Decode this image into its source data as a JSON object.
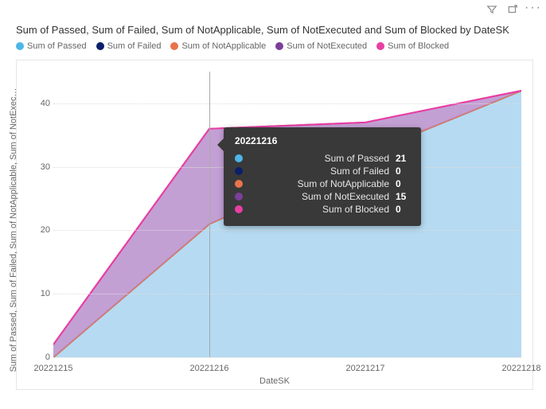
{
  "title": "Sum of Passed, Sum of Failed, Sum of NotApplicable, Sum of NotExecuted and Sum of Blocked by DateSK",
  "xlabel": "DateSK",
  "ylabel": "Sum of Passed, Sum of Failed, Sum of NotApplicable, Sum of NotExec…",
  "legend": {
    "passed": "Sum of Passed",
    "failed": "Sum of Failed",
    "na": "Sum of NotApplicable",
    "ne": "Sum of NotExecuted",
    "blocked": "Sum of Blocked"
  },
  "colors": {
    "passed": "#4db6e8",
    "failed": "#0b1f6b",
    "na": "#e8744c",
    "ne": "#7b3f9b",
    "blocked": "#e83ea3",
    "passed_fill": "#a8d4ee",
    "ne_fill": "#b98fcc"
  },
  "yticks": [
    "0",
    "10",
    "20",
    "30",
    "40"
  ],
  "xticks": [
    "20221215",
    "20221216",
    "20221217",
    "20221218"
  ],
  "tooltip": {
    "title": "20221216",
    "rows": [
      {
        "label": "Sum of Passed",
        "value": "21",
        "colorKey": "passed"
      },
      {
        "label": "Sum of Failed",
        "value": "0",
        "colorKey": "failed"
      },
      {
        "label": "Sum of NotApplicable",
        "value": "0",
        "colorKey": "na"
      },
      {
        "label": "Sum of NotExecuted",
        "value": "15",
        "colorKey": "ne"
      },
      {
        "label": "Sum of Blocked",
        "value": "0",
        "colorKey": "blocked"
      }
    ]
  },
  "chart_data": {
    "type": "area",
    "stacked": true,
    "categories": [
      "20221215",
      "20221216",
      "20221217",
      "20221218"
    ],
    "series": [
      {
        "name": "Sum of Passed",
        "values": [
          0,
          21,
          32,
          42
        ]
      },
      {
        "name": "Sum of Failed",
        "values": [
          0,
          0,
          0,
          0
        ]
      },
      {
        "name": "Sum of NotApplicable",
        "values": [
          0,
          0,
          0,
          0
        ]
      },
      {
        "name": "Sum of NotExecuted",
        "values": [
          2,
          15,
          5,
          0
        ]
      },
      {
        "name": "Sum of Blocked",
        "values": [
          0,
          0,
          0,
          0
        ]
      }
    ],
    "ylim": [
      0,
      45
    ],
    "yticks": [
      0,
      10,
      20,
      30,
      40
    ],
    "xlabel": "DateSK",
    "ylabel": "Sum of Passed, Sum of Failed, Sum of NotApplicable, Sum of NotExecuted and Sum of Blocked",
    "title": "Sum of Passed, Sum of Failed, Sum of NotApplicable, Sum of NotExecuted and Sum of Blocked by DateSK"
  }
}
